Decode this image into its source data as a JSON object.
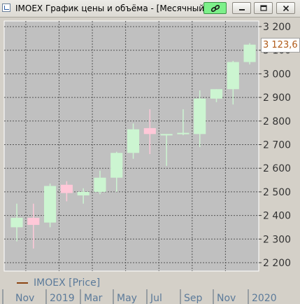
{
  "window": {
    "title": "IMOEX График цены и объёма - [Месячный]",
    "buttons": {
      "link": "link-icon",
      "minimize": "minimize-icon",
      "maximize": "maximize-icon",
      "close": "close-icon"
    }
  },
  "price_tag": "3 123,6",
  "legend": {
    "label": "IMOEX [Price]",
    "color": "#8b4513"
  },
  "colors": {
    "up": "#ccf5d1",
    "down": "#ffc8d8",
    "wick_up": "#ccf5d1",
    "wick_down": "#ffc8d8",
    "plot_bg": "#c0c0c0",
    "grid": "#555555"
  },
  "chart_data": {
    "type": "candlestick",
    "ylim": [
      2150,
      3250
    ],
    "y_ticks": [
      2200,
      2300,
      2400,
      2500,
      2600,
      2700,
      2800,
      2900,
      3000,
      3100,
      3200
    ],
    "y_tick_labels": [
      "2 200",
      "2 300",
      "2 400",
      "2 500",
      "2 600",
      "2 700",
      "2 800",
      "2 900",
      "3 000",
      "3 100",
      "3 200"
    ],
    "x_labels": [
      "Nov",
      "2019",
      "Mar",
      "May",
      "Jul",
      "Sep",
      "Nov",
      "2020"
    ],
    "candles": [
      {
        "open": 2350,
        "high": 2450,
        "low": 2290,
        "close": 2390
      },
      {
        "open": 2390,
        "high": 2450,
        "low": 2260,
        "close": 2360
      },
      {
        "open": 2370,
        "high": 2535,
        "low": 2350,
        "close": 2525
      },
      {
        "open": 2530,
        "high": 2545,
        "low": 2460,
        "close": 2495
      },
      {
        "open": 2485,
        "high": 2515,
        "low": 2450,
        "close": 2500
      },
      {
        "open": 2500,
        "high": 2590,
        "low": 2490,
        "close": 2560
      },
      {
        "open": 2560,
        "high": 2670,
        "low": 2500,
        "close": 2665
      },
      {
        "open": 2665,
        "high": 2790,
        "low": 2640,
        "close": 2765
      },
      {
        "open": 2770,
        "high": 2850,
        "low": 2660,
        "close": 2745
      },
      {
        "open": 2740,
        "high": 2745,
        "low": 2610,
        "close": 2745
      },
      {
        "open": 2745,
        "high": 2850,
        "low": 2740,
        "close": 2750
      },
      {
        "open": 2745,
        "high": 2930,
        "low": 2690,
        "close": 2895
      },
      {
        "open": 2895,
        "high": 2935,
        "low": 2880,
        "close": 2935
      },
      {
        "open": 2935,
        "high": 3055,
        "low": 2870,
        "close": 3050
      },
      {
        "open": 3050,
        "high": 3130,
        "low": 3040,
        "close": 3123.6
      }
    ]
  }
}
